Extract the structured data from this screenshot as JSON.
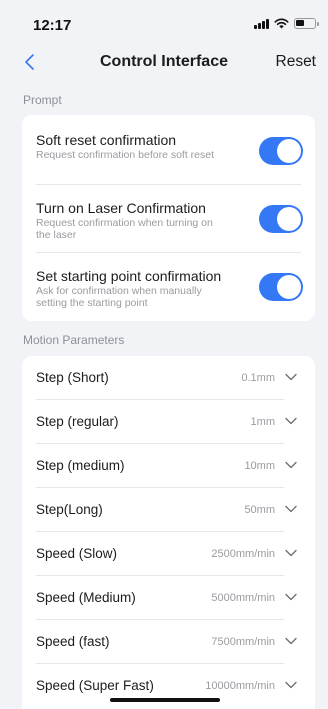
{
  "status_bar": {
    "time": "12:17"
  },
  "nav": {
    "title": "Control Interface",
    "reset_label": "Reset"
  },
  "prompt_section": {
    "header": "Prompt",
    "items": [
      {
        "title": "Soft reset confirmation",
        "desc": "Request confirmation before soft reset",
        "enabled": true
      },
      {
        "title": "Turn on Laser Confirmation",
        "desc": "Request confirmation when turning on the laser",
        "enabled": true
      },
      {
        "title": "Set starting point confirmation",
        "desc": "Ask for confirmation when manually setting the starting point",
        "enabled": true
      }
    ]
  },
  "motion_section": {
    "header": "Motion Parameters",
    "items": [
      {
        "label": "Step (Short)",
        "value": "0.1mm"
      },
      {
        "label": "Step (regular)",
        "value": "1mm"
      },
      {
        "label": "Step (medium)",
        "value": "10mm"
      },
      {
        "label": "Step(Long)",
        "value": "50mm"
      },
      {
        "label": "Speed (Slow)",
        "value": "2500mm/min"
      },
      {
        "label": "Speed (Medium)",
        "value": "5000mm/min"
      },
      {
        "label": "Speed (fast)",
        "value": "7500mm/min"
      },
      {
        "label": "Speed (Super Fast)",
        "value": "10000mm/min"
      }
    ]
  },
  "colors": {
    "accent": "#3478f6",
    "background": "#f2f3f7",
    "card": "#ffffff",
    "secondary_text": "#9a9ba0"
  }
}
